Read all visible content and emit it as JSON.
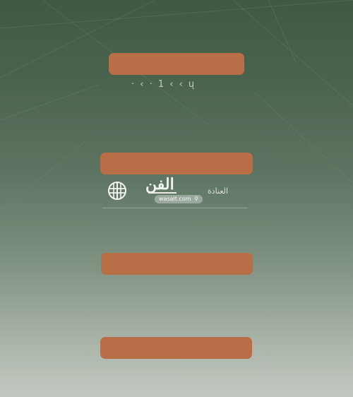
{
  "header": {
    "faint_caption": "· ‹ · 1 ‹ ‹ ų"
  },
  "branding": {
    "logo_text": "الفن",
    "right_label": "العنادة",
    "watermark": "wasalt.com",
    "pin_icon": "location-pin-icon",
    "globe_icon": "globe-icon"
  },
  "colors": {
    "background_top": "#3f5a43",
    "background_bottom": "#c2c8c0",
    "bar": "#b86f47"
  }
}
